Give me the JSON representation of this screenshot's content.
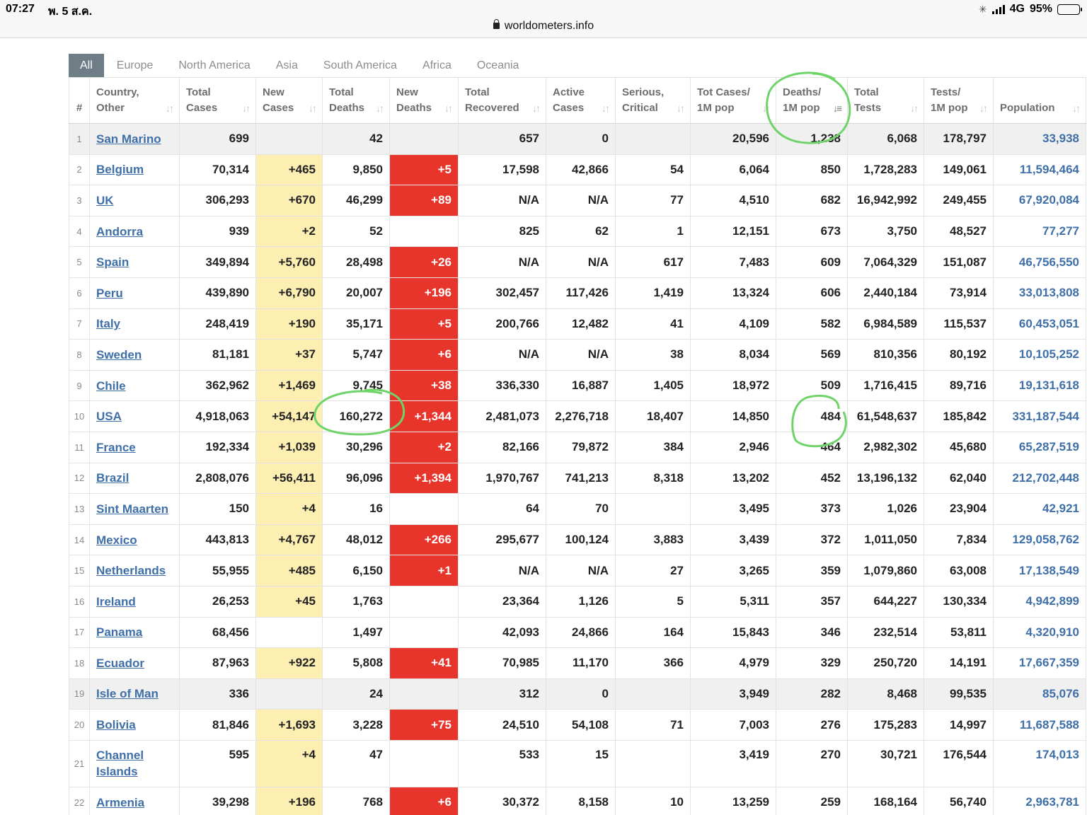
{
  "status_bar": {
    "time": "07:27",
    "date": "พ. 5 ส.ค.",
    "network": "4G",
    "battery": "95%",
    "battery_level": 0.95
  },
  "address_bar": {
    "url": "worldometers.info"
  },
  "tabs": [
    "All",
    "Europe",
    "North America",
    "Asia",
    "South America",
    "Africa",
    "Oceania"
  ],
  "active_tab": "All",
  "columns": [
    {
      "l1": "#",
      "l2": ""
    },
    {
      "l1": "Country,",
      "l2": "Other"
    },
    {
      "l1": "Total",
      "l2": "Cases"
    },
    {
      "l1": "New",
      "l2": "Cases"
    },
    {
      "l1": "Total",
      "l2": "Deaths"
    },
    {
      "l1": "New",
      "l2": "Deaths"
    },
    {
      "l1": "Total",
      "l2": "Recovered"
    },
    {
      "l1": "Active",
      "l2": "Cases"
    },
    {
      "l1": "Serious,",
      "l2": "Critical"
    },
    {
      "l1": "Tot Cases/",
      "l2": "1M pop"
    },
    {
      "l1": "Deaths/",
      "l2": "1M pop"
    },
    {
      "l1": "Total",
      "l2": "Tests"
    },
    {
      "l1": "Tests/",
      "l2": "1M pop"
    },
    {
      "l1": "",
      "l2": "Population"
    }
  ],
  "sorted_column": "Deaths/ 1M pop",
  "rows": [
    {
      "num": "1",
      "country": "San Marino",
      "total_cases": "699",
      "new_cases": "",
      "total_deaths": "42",
      "new_deaths": "",
      "total_recovered": "657",
      "active_cases": "0",
      "serious": "",
      "cases_per_1m": "20,596",
      "deaths_per_1m": "1,238",
      "total_tests": "6,068",
      "tests_per_1m": "178,797",
      "population": "33,938",
      "gray": true
    },
    {
      "num": "2",
      "country": "Belgium",
      "total_cases": "70,314",
      "new_cases": "+465",
      "total_deaths": "9,850",
      "new_deaths": "+5",
      "total_recovered": "17,598",
      "active_cases": "42,866",
      "serious": "54",
      "cases_per_1m": "6,064",
      "deaths_per_1m": "850",
      "total_tests": "1,728,283",
      "tests_per_1m": "149,061",
      "population": "11,594,464"
    },
    {
      "num": "3",
      "country": "UK",
      "total_cases": "306,293",
      "new_cases": "+670",
      "total_deaths": "46,299",
      "new_deaths": "+89",
      "total_recovered": "N/A",
      "active_cases": "N/A",
      "serious": "77",
      "cases_per_1m": "4,510",
      "deaths_per_1m": "682",
      "total_tests": "16,942,992",
      "tests_per_1m": "249,455",
      "population": "67,920,084"
    },
    {
      "num": "4",
      "country": "Andorra",
      "total_cases": "939",
      "new_cases": "+2",
      "total_deaths": "52",
      "new_deaths": "",
      "total_recovered": "825",
      "active_cases": "62",
      "serious": "1",
      "cases_per_1m": "12,151",
      "deaths_per_1m": "673",
      "total_tests": "3,750",
      "tests_per_1m": "48,527",
      "population": "77,277"
    },
    {
      "num": "5",
      "country": "Spain",
      "total_cases": "349,894",
      "new_cases": "+5,760",
      "total_deaths": "28,498",
      "new_deaths": "+26",
      "total_recovered": "N/A",
      "active_cases": "N/A",
      "serious": "617",
      "cases_per_1m": "7,483",
      "deaths_per_1m": "609",
      "total_tests": "7,064,329",
      "tests_per_1m": "151,087",
      "population": "46,756,550"
    },
    {
      "num": "6",
      "country": "Peru",
      "total_cases": "439,890",
      "new_cases": "+6,790",
      "total_deaths": "20,007",
      "new_deaths": "+196",
      "total_recovered": "302,457",
      "active_cases": "117,426",
      "serious": "1,419",
      "cases_per_1m": "13,324",
      "deaths_per_1m": "606",
      "total_tests": "2,440,184",
      "tests_per_1m": "73,914",
      "population": "33,013,808"
    },
    {
      "num": "7",
      "country": "Italy",
      "total_cases": "248,419",
      "new_cases": "+190",
      "total_deaths": "35,171",
      "new_deaths": "+5",
      "total_recovered": "200,766",
      "active_cases": "12,482",
      "serious": "41",
      "cases_per_1m": "4,109",
      "deaths_per_1m": "582",
      "total_tests": "6,984,589",
      "tests_per_1m": "115,537",
      "population": "60,453,051"
    },
    {
      "num": "8",
      "country": "Sweden",
      "total_cases": "81,181",
      "new_cases": "+37",
      "total_deaths": "5,747",
      "new_deaths": "+6",
      "total_recovered": "N/A",
      "active_cases": "N/A",
      "serious": "38",
      "cases_per_1m": "8,034",
      "deaths_per_1m": "569",
      "total_tests": "810,356",
      "tests_per_1m": "80,192",
      "population": "10,105,252"
    },
    {
      "num": "9",
      "country": "Chile",
      "total_cases": "362,962",
      "new_cases": "+1,469",
      "total_deaths": "9,745",
      "new_deaths": "+38",
      "total_recovered": "336,330",
      "active_cases": "16,887",
      "serious": "1,405",
      "cases_per_1m": "18,972",
      "deaths_per_1m": "509",
      "total_tests": "1,716,415",
      "tests_per_1m": "89,716",
      "population": "19,131,618"
    },
    {
      "num": "10",
      "country": "USA",
      "total_cases": "4,918,063",
      "new_cases": "+54,147",
      "total_deaths": "160,272",
      "new_deaths": "+1,344",
      "total_recovered": "2,481,073",
      "active_cases": "2,276,718",
      "serious": "18,407",
      "cases_per_1m": "14,850",
      "deaths_per_1m": "484",
      "total_tests": "61,548,637",
      "tests_per_1m": "185,842",
      "population": "331,187,544"
    },
    {
      "num": "11",
      "country": "France",
      "total_cases": "192,334",
      "new_cases": "+1,039",
      "total_deaths": "30,296",
      "new_deaths": "+2",
      "total_recovered": "82,166",
      "active_cases": "79,872",
      "serious": "384",
      "cases_per_1m": "2,946",
      "deaths_per_1m": "464",
      "total_tests": "2,982,302",
      "tests_per_1m": "45,680",
      "population": "65,287,519"
    },
    {
      "num": "12",
      "country": "Brazil",
      "total_cases": "2,808,076",
      "new_cases": "+56,411",
      "total_deaths": "96,096",
      "new_deaths": "+1,394",
      "total_recovered": "1,970,767",
      "active_cases": "741,213",
      "serious": "8,318",
      "cases_per_1m": "13,202",
      "deaths_per_1m": "452",
      "total_tests": "13,196,132",
      "tests_per_1m": "62,040",
      "population": "212,702,448"
    },
    {
      "num": "13",
      "country": "Sint Maarten",
      "total_cases": "150",
      "new_cases": "+4",
      "total_deaths": "16",
      "new_deaths": "",
      "total_recovered": "64",
      "active_cases": "70",
      "serious": "",
      "cases_per_1m": "3,495",
      "deaths_per_1m": "373",
      "total_tests": "1,026",
      "tests_per_1m": "23,904",
      "population": "42,921"
    },
    {
      "num": "14",
      "country": "Mexico",
      "total_cases": "443,813",
      "new_cases": "+4,767",
      "total_deaths": "48,012",
      "new_deaths": "+266",
      "total_recovered": "295,677",
      "active_cases": "100,124",
      "serious": "3,883",
      "cases_per_1m": "3,439",
      "deaths_per_1m": "372",
      "total_tests": "1,011,050",
      "tests_per_1m": "7,834",
      "population": "129,058,762"
    },
    {
      "num": "15",
      "country": "Netherlands",
      "total_cases": "55,955",
      "new_cases": "+485",
      "total_deaths": "6,150",
      "new_deaths": "+1",
      "total_recovered": "N/A",
      "active_cases": "N/A",
      "serious": "27",
      "cases_per_1m": "3,265",
      "deaths_per_1m": "359",
      "total_tests": "1,079,860",
      "tests_per_1m": "63,008",
      "population": "17,138,549"
    },
    {
      "num": "16",
      "country": "Ireland",
      "total_cases": "26,253",
      "new_cases": "+45",
      "total_deaths": "1,763",
      "new_deaths": "",
      "total_recovered": "23,364",
      "active_cases": "1,126",
      "serious": "5",
      "cases_per_1m": "5,311",
      "deaths_per_1m": "357",
      "total_tests": "644,227",
      "tests_per_1m": "130,334",
      "population": "4,942,899"
    },
    {
      "num": "17",
      "country": "Panama",
      "total_cases": "68,456",
      "new_cases": "",
      "total_deaths": "1,497",
      "new_deaths": "",
      "total_recovered": "42,093",
      "active_cases": "24,866",
      "serious": "164",
      "cases_per_1m": "15,843",
      "deaths_per_1m": "346",
      "total_tests": "232,514",
      "tests_per_1m": "53,811",
      "population": "4,320,910"
    },
    {
      "num": "18",
      "country": "Ecuador",
      "total_cases": "87,963",
      "new_cases": "+922",
      "total_deaths": "5,808",
      "new_deaths": "+41",
      "total_recovered": "70,985",
      "active_cases": "11,170",
      "serious": "366",
      "cases_per_1m": "4,979",
      "deaths_per_1m": "329",
      "total_tests": "250,720",
      "tests_per_1m": "14,191",
      "population": "17,667,359"
    },
    {
      "num": "19",
      "country": "Isle of Man",
      "total_cases": "336",
      "new_cases": "",
      "total_deaths": "24",
      "new_deaths": "",
      "total_recovered": "312",
      "active_cases": "0",
      "serious": "",
      "cases_per_1m": "3,949",
      "deaths_per_1m": "282",
      "total_tests": "8,468",
      "tests_per_1m": "99,535",
      "population": "85,076",
      "gray": true
    },
    {
      "num": "20",
      "country": "Bolivia",
      "total_cases": "81,846",
      "new_cases": "+1,693",
      "total_deaths": "3,228",
      "new_deaths": "+75",
      "total_recovered": "24,510",
      "active_cases": "54,108",
      "serious": "71",
      "cases_per_1m": "7,003",
      "deaths_per_1m": "276",
      "total_tests": "175,283",
      "tests_per_1m": "14,997",
      "population": "11,687,588"
    },
    {
      "num": "21",
      "country": "Channel Islands",
      "total_cases": "595",
      "new_cases": "+4",
      "total_deaths": "47",
      "new_deaths": "",
      "total_recovered": "533",
      "active_cases": "15",
      "serious": "",
      "cases_per_1m": "3,419",
      "deaths_per_1m": "270",
      "total_tests": "30,721",
      "tests_per_1m": "176,544",
      "population": "174,013",
      "tall": true
    },
    {
      "num": "22",
      "country": "Armenia",
      "total_cases": "39,298",
      "new_cases": "+196",
      "total_deaths": "768",
      "new_deaths": "+6",
      "total_recovered": "30,372",
      "active_cases": "8,158",
      "serious": "10",
      "cases_per_1m": "13,259",
      "deaths_per_1m": "259",
      "total_tests": "168,164",
      "tests_per_1m": "56,740",
      "population": "2,963,781"
    }
  ],
  "colors": {
    "tab_active_bg": "#6e7d86",
    "new_cases_bg": "#fdefb2",
    "new_deaths_bg": "#e8352b",
    "link": "#3f6fa8",
    "annotation_green": "#6fd36a"
  }
}
